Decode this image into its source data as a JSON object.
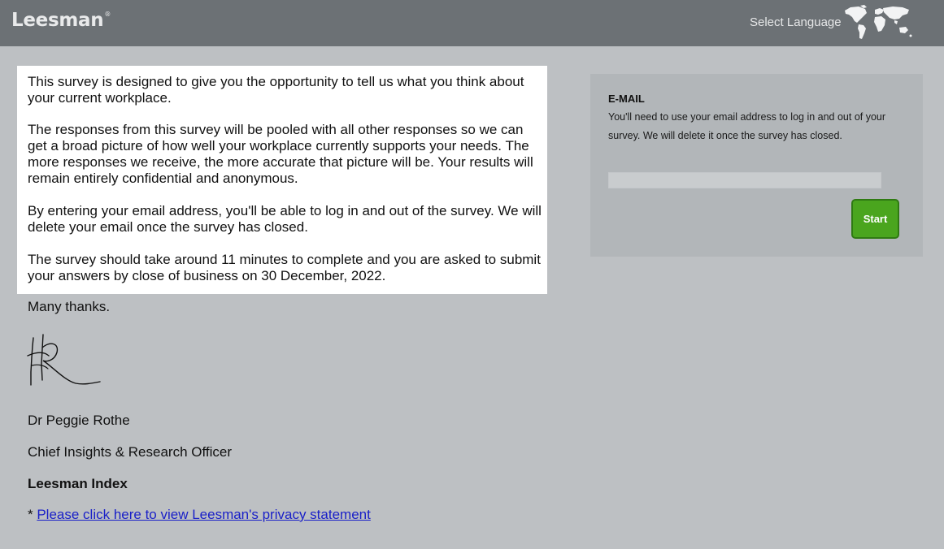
{
  "header": {
    "logo": "Leesman",
    "logo_mark": "®",
    "select_language": "Select Language",
    "globe_icon": "world-map-icon"
  },
  "intro": {
    "paragraphs": [
      "This survey is designed to give you the opportunity to tell us what you think about your current workplace.",
      "The responses from this survey will be pooled with all other responses so we can get a broad picture of how well your workplace currently supports your needs. The more responses we receive, the more accurate that picture will be. Your results will remain entirely confidential and anonymous.",
      "By entering your email address, you'll be able to log in and out of the survey. We will delete your email once the survey has closed.",
      "The survey should take around 11 minutes to complete and you are asked to submit your answers by close of business on 30 December, 2022."
    ],
    "thanks": "Many thanks.",
    "signer_name": "Dr Peggie Rothe",
    "signer_title": "Chief Insights & Research Officer",
    "organization": "Leesman Index",
    "privacy_prefix": "* ",
    "privacy_link": "Please click here to view Leesman's privacy statement"
  },
  "email_panel": {
    "title": "E-MAIL",
    "description": "You'll need to use your email address to log in and out of your survey. We will delete it once the survey has closed.",
    "input_value": "",
    "start_label": "Start"
  },
  "colors": {
    "header_bg": "#6c7175",
    "page_bg": "#bdc0c3",
    "panel_bg": "#b2b6b9",
    "start_button": "#4aa51e",
    "link": "#1a20c8"
  }
}
